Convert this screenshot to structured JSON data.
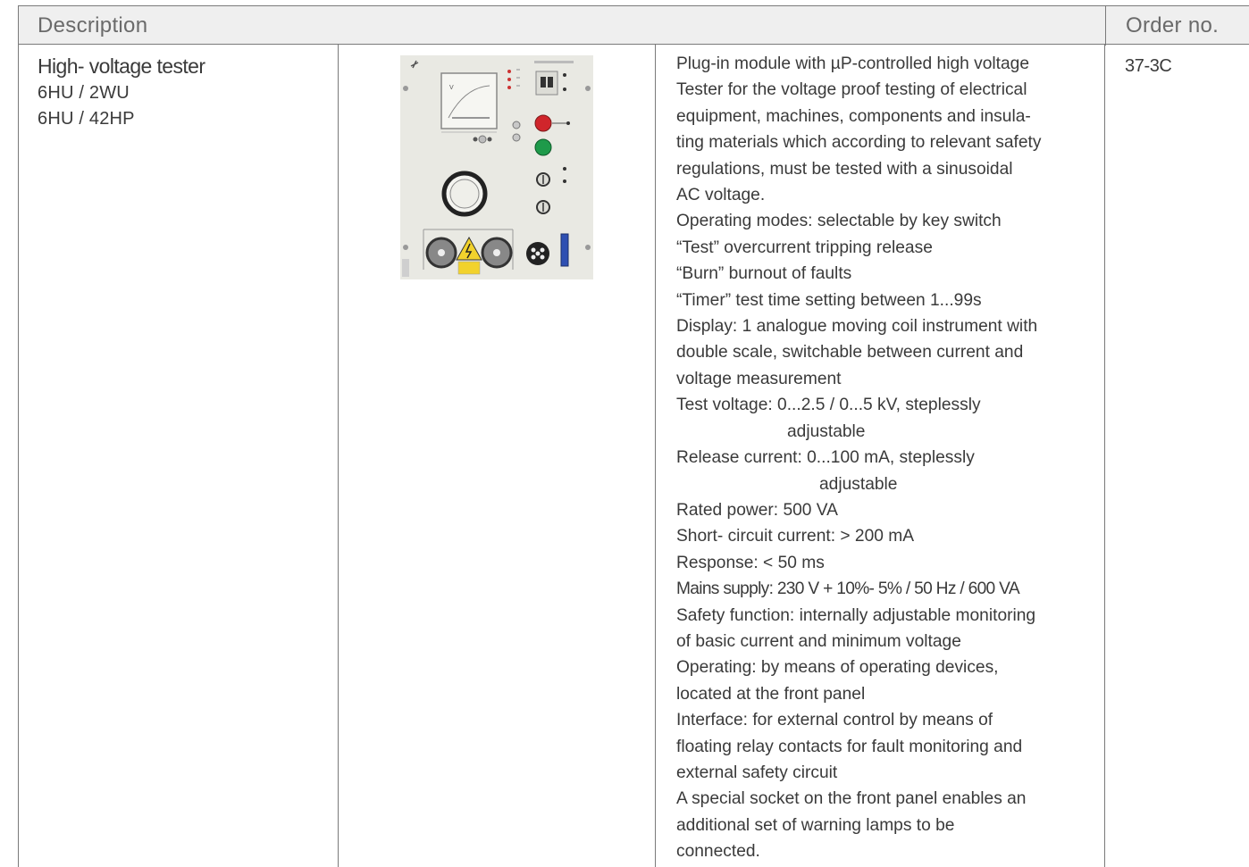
{
  "table": {
    "header": {
      "description": "Description",
      "order_no": "Order no."
    },
    "row": {
      "name": "High- voltage tester",
      "specs": [
        "6HU / 2WU",
        "6HU / 42HP"
      ],
      "description_lines": [
        "Plug-in module with µP-controlled high voltage",
        "Tester for the voltage proof testing of electrical",
        "equipment, machines, components and insula-",
        "ting materials which according to relevant safety",
        "regulations, must be tested with a sinusoidal",
        "AC voltage.",
        "Operating modes: selectable by key switch",
        "“Test” overcurrent tripping release",
        "“Burn” burnout of faults",
        "“Timer” test time setting between 1...99s",
        "Display: 1 analogue moving coil instrument with",
        "double scale, switchable between current and",
        "voltage measurement",
        "Test voltage: 0...2.5 / 0...5 kV, steplessly",
        "adjustable",
        "Release current: 0...100 mA, steplessly",
        "adjustable",
        "Rated power: 500 VA",
        "Short- circuit current: > 200 mA",
        "Response: < 50 ms",
        "Mains supply: 230 V + 10%- 5% / 50 Hz / 600 VA",
        "Safety function: internally adjustable monitoring",
        "of basic current and minimum voltage",
        "Operating: by means of operating devices,",
        "located at the front panel",
        "Interface: for external control by means of",
        "floating relay contacts for fault monitoring and",
        "external safety circuit",
        "A special socket on the front panel enables an",
        "additional set of warning lamps to be",
        "connected."
      ],
      "order_no": "37-3C"
    }
  },
  "colors": {
    "header_bg": "#efefef",
    "rule": "#7a7a7a",
    "text": "#3a3a3a",
    "header_text": "#6a6a6a",
    "panel": "#e9e9e3",
    "lamp_red": "#d0252b",
    "lamp_green": "#1e9a4a",
    "warning_yellow": "#f2d22c",
    "fuse_blue": "#2e4fb2"
  },
  "icons": [
    "high-voltage-tester-module-image",
    "warning-triangle-icon",
    "analogue-meter-icon"
  ]
}
